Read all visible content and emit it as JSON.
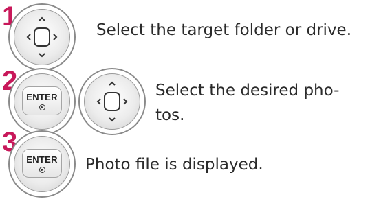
{
  "steps": [
    {
      "number": "1",
      "text": "Select the target folder or drive.",
      "buttons": [
        "navigation-pad"
      ]
    },
    {
      "number": "2",
      "text": "Select the desired pho-\ntos.",
      "buttons": [
        "enter-button",
        "navigation-pad"
      ]
    },
    {
      "number": "3",
      "text": "Photo file is displayed.",
      "buttons": [
        "enter-button"
      ]
    }
  ],
  "button_labels": {
    "enter": "ENTER"
  },
  "colors": {
    "step_number": "#c8185a",
    "text": "#2b2b2b",
    "outline": "#8a8a8a"
  }
}
